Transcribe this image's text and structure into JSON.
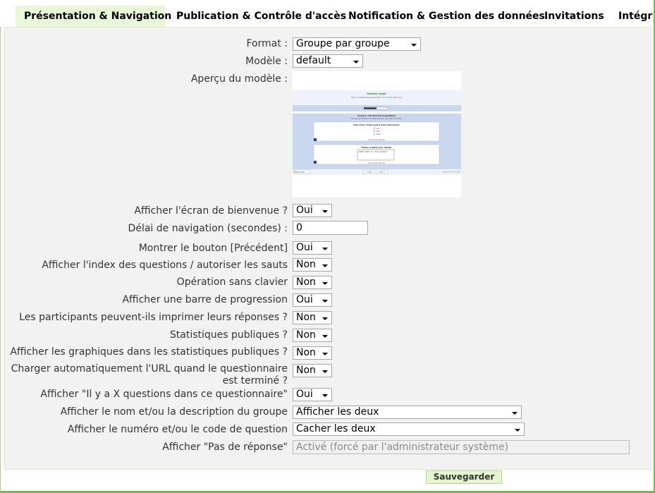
{
  "tabs": [
    {
      "label": "Présentation & Navigation"
    },
    {
      "label": "Publication & Contrôle d'accès"
    },
    {
      "label": "Notification & Gestion des données"
    },
    {
      "label": "Invitations"
    },
    {
      "label": "Intégra"
    }
  ],
  "fields": {
    "format": {
      "label": "Format :",
      "value": "Groupe par groupe"
    },
    "modele": {
      "label": "Modèle :",
      "value": "default"
    },
    "apercu": {
      "label": "Aperçu du modèle :"
    },
    "bienvenue": {
      "label": "Afficher l'écran de bienvenue ?",
      "value": "Oui"
    },
    "delai": {
      "label": "Délai de navigation (secondes) :",
      "value": "0"
    },
    "precedent": {
      "label": "Montrer le bouton [Précédent]",
      "value": "Oui"
    },
    "index": {
      "label": "Afficher l'index des questions / autoriser les sauts",
      "value": "Non"
    },
    "clavier": {
      "label": "Opération sans clavier",
      "value": "Non"
    },
    "progression": {
      "label": "Afficher une barre de progression",
      "value": "Oui"
    },
    "imprimer": {
      "label": "Les participants peuvent-ils imprimer leurs réponses ?",
      "value": "Non"
    },
    "stats": {
      "label": "Statistiques publiques ?",
      "value": "Non"
    },
    "graphiques": {
      "label": "Afficher les graphiques dans les statistiques publiques ?",
      "value": "Non"
    },
    "url": {
      "label": "Charger automatiquement l'URL quand le questionnaire est terminé ?",
      "value": "Non"
    },
    "xquestions": {
      "label": "Afficher \"Il y a X questions dans ce questionnaire\"",
      "value": "Oui"
    },
    "groupe": {
      "label": "Afficher le nom et/ou la description du groupe",
      "value": "Afficher les deux"
    },
    "numero": {
      "label": "Afficher le numéro et/ou le code de question",
      "value": "Cacher les deux"
    },
    "pasreponse": {
      "label": "Afficher \"Pas de réponse\"",
      "value": "Activé (forcé par l'administrateur système)"
    }
  },
  "save_label": "Sauvegarder",
  "preview_text": {
    "title": "Sample Login",
    "desc": "This is a sample survey description. It could be quite long.",
    "group": "Group 1: The first lot of questions",
    "group_desc": "This group description is fairly vacuous, but quite important.",
    "q1": "How many roads must a man walk down?",
    "q1_opts": [
      "one",
      "Two",
      "None"
    ],
    "q2": "Please explain your details",
    "q2_answer": "Some text in this answer",
    "help": "This is some help text",
    "resume": "Resume Later",
    "prev": "<< prev",
    "next": "next >>",
    "clear": "[Exit and Clear Survey]"
  },
  "colors": {
    "accent": "#7ab648",
    "active_tab_bg": "#eaf6d8",
    "panel_bg": "#f2f2f2",
    "save_bg": "#e6f5cf"
  }
}
